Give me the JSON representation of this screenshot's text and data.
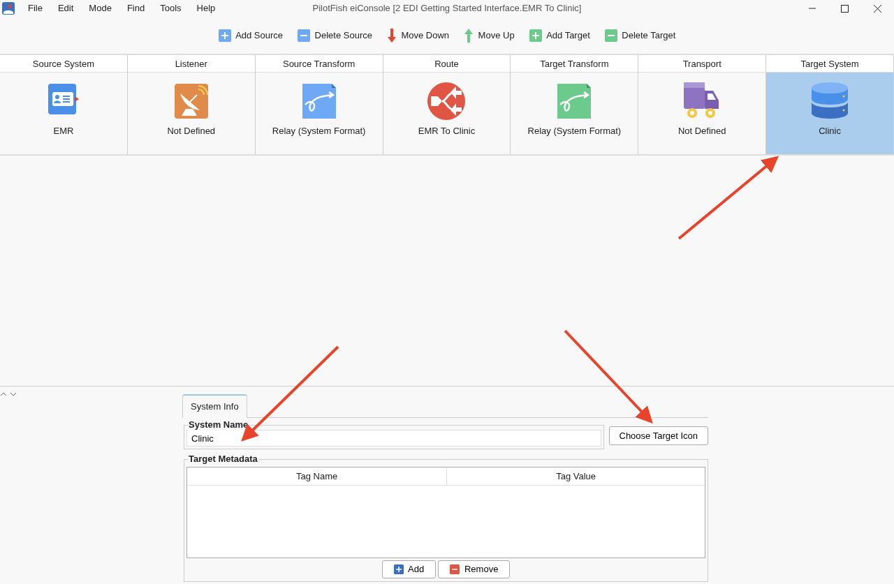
{
  "window": {
    "title": "PilotFish eiConsole [2 EDI Getting Started Interface.EMR To Clinic]"
  },
  "menu": [
    "File",
    "Edit",
    "Mode",
    "Find",
    "Tools",
    "Help"
  ],
  "toolbar": [
    {
      "label": "Add Source",
      "kind": "add",
      "color": "#6fa8f5"
    },
    {
      "label": "Delete Source",
      "kind": "remove",
      "color": "#6fa8f5"
    },
    {
      "label": "Move Down",
      "kind": "down",
      "color": "#e8442c"
    },
    {
      "label": "Move Up",
      "kind": "up",
      "color": "#6ccb8c"
    },
    {
      "label": "Add Target",
      "kind": "add",
      "color": "#6ccb8c"
    },
    {
      "label": "Delete Target",
      "kind": "remove",
      "color": "#6ccb8c"
    }
  ],
  "stages": [
    {
      "header": "Source System",
      "label": "EMR",
      "kind": "card",
      "selected": false
    },
    {
      "header": "Listener",
      "label": "Not Defined",
      "kind": "dish",
      "selected": false
    },
    {
      "header": "Source Transform",
      "label": "Relay (System Format)",
      "kind": "relay-blue",
      "selected": false
    },
    {
      "header": "Route",
      "label": "EMR To Clinic",
      "kind": "route",
      "selected": false
    },
    {
      "header": "Target Transform",
      "label": "Relay (System Format)",
      "kind": "relay-green",
      "selected": false
    },
    {
      "header": "Transport",
      "label": "Not Defined",
      "kind": "truck",
      "selected": false
    },
    {
      "header": "Target System",
      "label": "Clinic",
      "kind": "database",
      "selected": true
    }
  ],
  "tabs": [
    {
      "label": "System Info",
      "selected": true
    }
  ],
  "system_name": {
    "legend": "System Name",
    "value": "Clinic"
  },
  "choose_button": "Choose Target Icon",
  "metadata": {
    "legend": "Target Metadata",
    "columns": [
      "Tag Name",
      "Tag Value"
    ],
    "buttons": [
      {
        "label": "Add",
        "kind": "add"
      },
      {
        "label": "Remove",
        "kind": "remove"
      }
    ]
  }
}
